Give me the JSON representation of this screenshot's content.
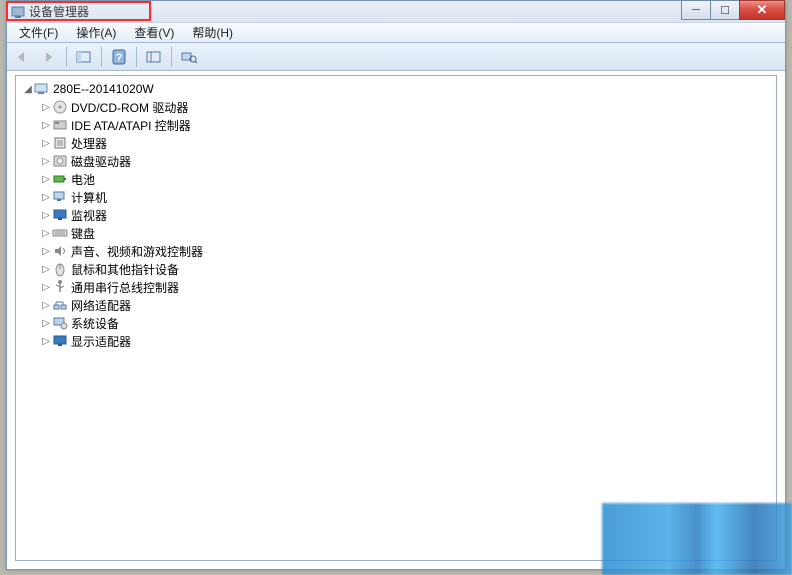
{
  "window": {
    "title": "设备管理器"
  },
  "menubar": {
    "file": "文件(F)",
    "action": "操作(A)",
    "view": "查看(V)",
    "help": "帮助(H)"
  },
  "tree": {
    "root": "280E--20141020W",
    "nodes": [
      {
        "label": "DVD/CD-ROM 驱动器",
        "icon": "disc"
      },
      {
        "label": "IDE ATA/ATAPI 控制器",
        "icon": "ide"
      },
      {
        "label": "处理器",
        "icon": "cpu"
      },
      {
        "label": "磁盘驱动器",
        "icon": "disk"
      },
      {
        "label": "电池",
        "icon": "battery"
      },
      {
        "label": "计算机",
        "icon": "computer"
      },
      {
        "label": "监视器",
        "icon": "monitor"
      },
      {
        "label": "键盘",
        "icon": "keyboard"
      },
      {
        "label": "声音、视频和游戏控制器",
        "icon": "sound"
      },
      {
        "label": "鼠标和其他指针设备",
        "icon": "mouse"
      },
      {
        "label": "通用串行总线控制器",
        "icon": "usb"
      },
      {
        "label": "网络适配器",
        "icon": "network"
      },
      {
        "label": "系统设备",
        "icon": "system"
      },
      {
        "label": "显示适配器",
        "icon": "display"
      }
    ]
  },
  "icons": {
    "pc": "🖥",
    "disc": "💿",
    "ide": "📼",
    "cpu": "▢",
    "disk": "🖴",
    "battery": "🔋",
    "computer": "💻",
    "monitor": "🖵",
    "keyboard": "⌨",
    "sound": "🔊",
    "mouse": "🖱",
    "usb": "ψ",
    "network": "🖧",
    "system": "⚙",
    "display": "🖥"
  }
}
